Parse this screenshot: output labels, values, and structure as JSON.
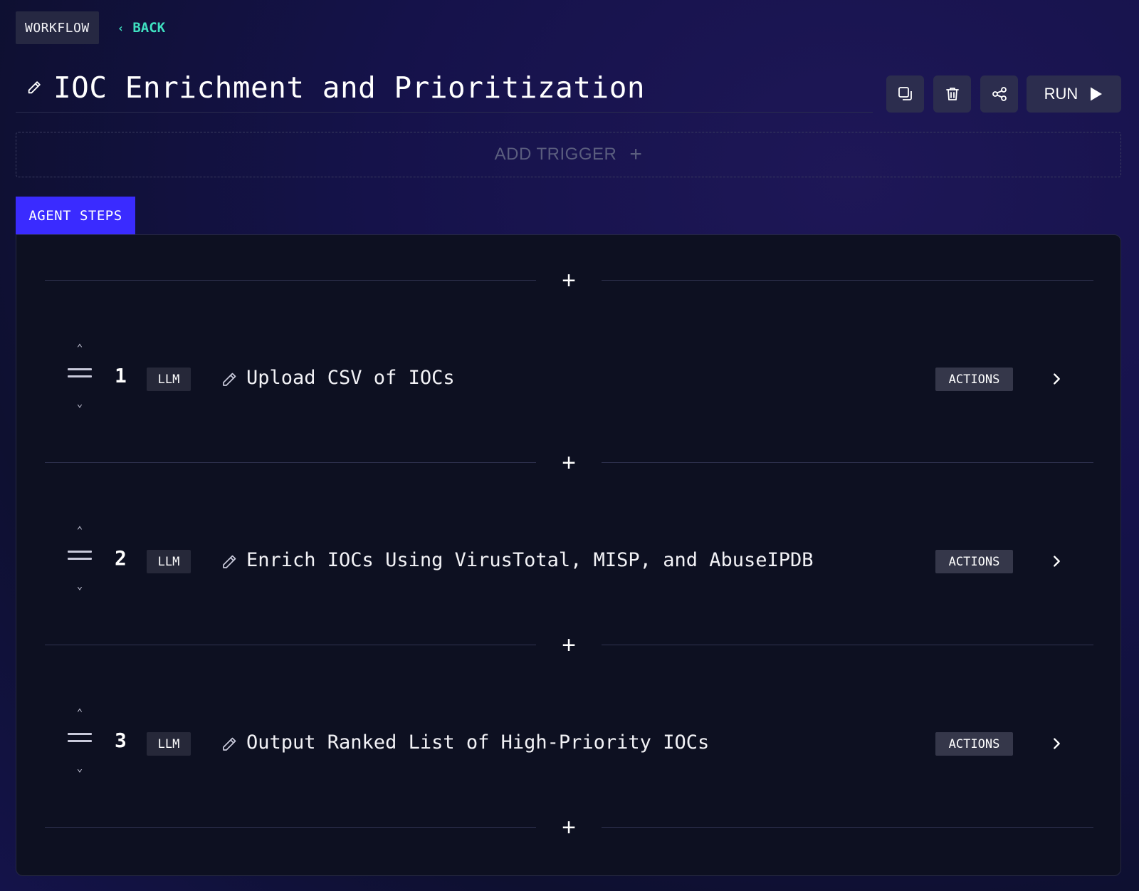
{
  "header": {
    "breadcrumb": "WORKFLOW",
    "back_label": "BACK",
    "title": "IOC Enrichment and Prioritization"
  },
  "toolbar": {
    "run_label": "RUN"
  },
  "trigger": {
    "label": "ADD TRIGGER",
    "plus": "+"
  },
  "tabs": {
    "agent_steps": "AGENT STEPS"
  },
  "steps": [
    {
      "number": "1",
      "type": "LLM",
      "name": "Upload CSV of IOCs",
      "actions_label": "ACTIONS"
    },
    {
      "number": "2",
      "type": "LLM",
      "name": "Enrich IOCs Using VirusTotal, MISP, and AbuseIPDB",
      "actions_label": "ACTIONS"
    },
    {
      "number": "3",
      "type": "LLM",
      "name": "Output Ranked List of High-Priority IOCs",
      "actions_label": "ACTIONS"
    }
  ],
  "add_step_symbol": "+",
  "icons": {
    "reorder_up": "⌃",
    "reorder_down": "⌄",
    "back_chevron": "‹"
  },
  "colors": {
    "accent_tab": "#3a2bff",
    "back_link": "#3fe0c0"
  }
}
